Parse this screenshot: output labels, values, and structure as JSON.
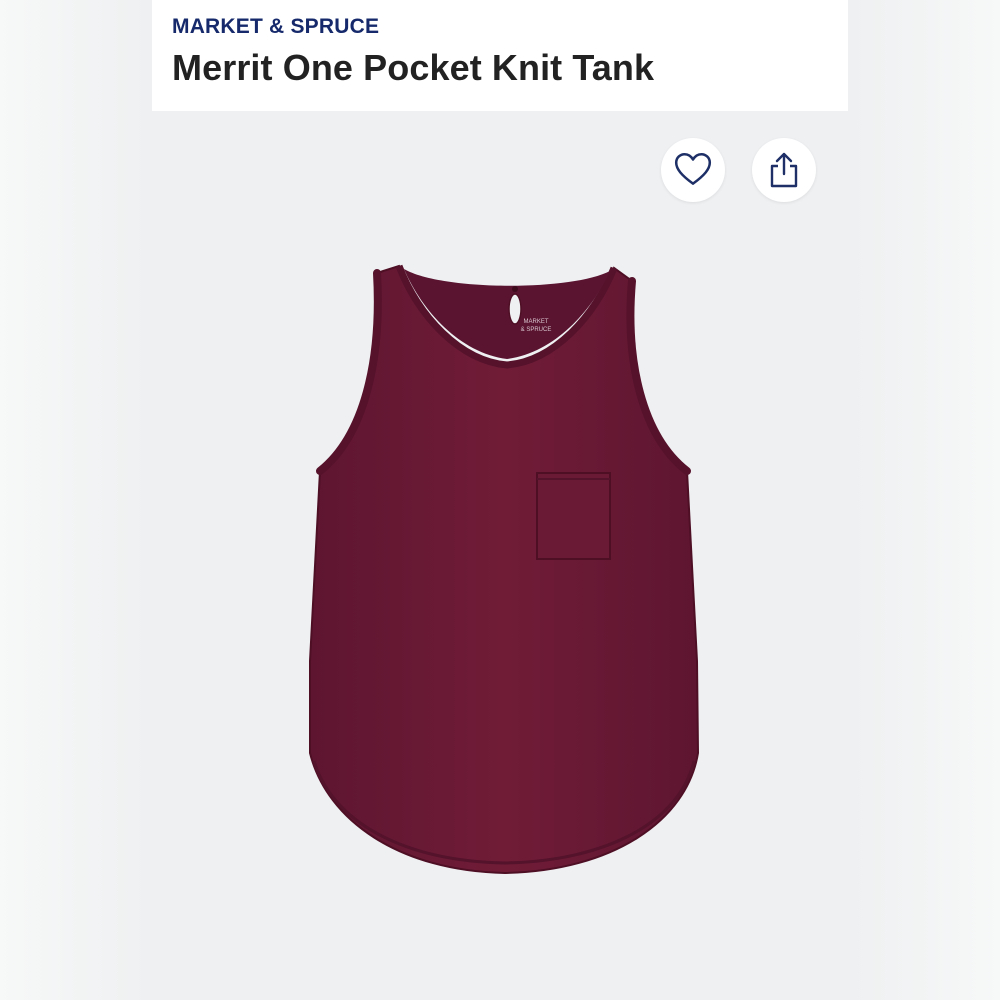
{
  "product": {
    "brand": "MARKET & SPRUCE",
    "title": "Merrit One Pocket Knit Tank",
    "image_alt": "Burgundy one pocket knit tank top",
    "color": "#6e1a35"
  },
  "actions": {
    "favorite_icon": "heart-icon",
    "share_icon": "share-icon"
  },
  "garment_label": {
    "line1": "MARKET",
    "line2": "& SPRUCE"
  }
}
